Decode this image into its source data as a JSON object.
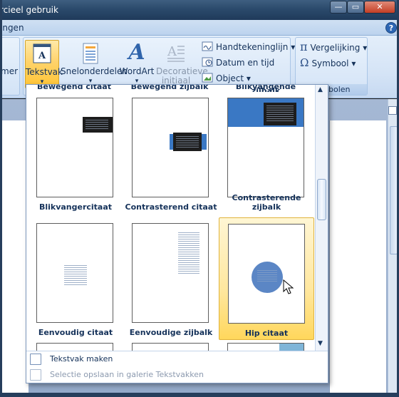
{
  "window": {
    "title": "rcieel gebruik",
    "controls": {
      "minimize": "—",
      "maximize": "▭",
      "close": "✕"
    }
  },
  "ribbon": {
    "tab_label": "ingen",
    "help": "?",
    "left_fragment": "mer",
    "buttons": {
      "tekstvak": "Tekstvak",
      "snelonderdelen": "Snelonderdelen",
      "wordart": "WordArt",
      "decoratieve_initiaal_line1": "Decoratieve",
      "decoratieve_initiaal_line2": "initiaal",
      "handtekeninglijn": "Handtekeninglijn",
      "datum_en_tijd": "Datum en tijd",
      "object": "Object",
      "vergelijking": "Vergelijking",
      "symbool": "Symbool"
    },
    "group_symbols_caption": "bolen",
    "icons": {
      "pi": "π",
      "omega": "Ω",
      "wordart_glyph": "A",
      "dropdown": "▾"
    }
  },
  "gallery": {
    "cut_labels": [
      "Bewegend citaat",
      "Bewegend zijbalk",
      "Blikvangende zijbalk"
    ],
    "items": [
      {
        "label": "Blikvangercitaat"
      },
      {
        "label": "Contrasterend citaat"
      },
      {
        "label": "Contrasterende zijbalk"
      },
      {
        "label": "Eenvoudig citaat"
      },
      {
        "label": "Eenvoudige zijbalk"
      },
      {
        "label": "Hip citaat"
      }
    ],
    "menu": {
      "make": "Tekstvak maken",
      "save": "Selectie opslaan in galerie Tekstvakken"
    },
    "colors": {
      "hover_border": "#e0b33c",
      "accent_blue": "#3a78c4",
      "dark_box": "#1d1d1d"
    }
  }
}
